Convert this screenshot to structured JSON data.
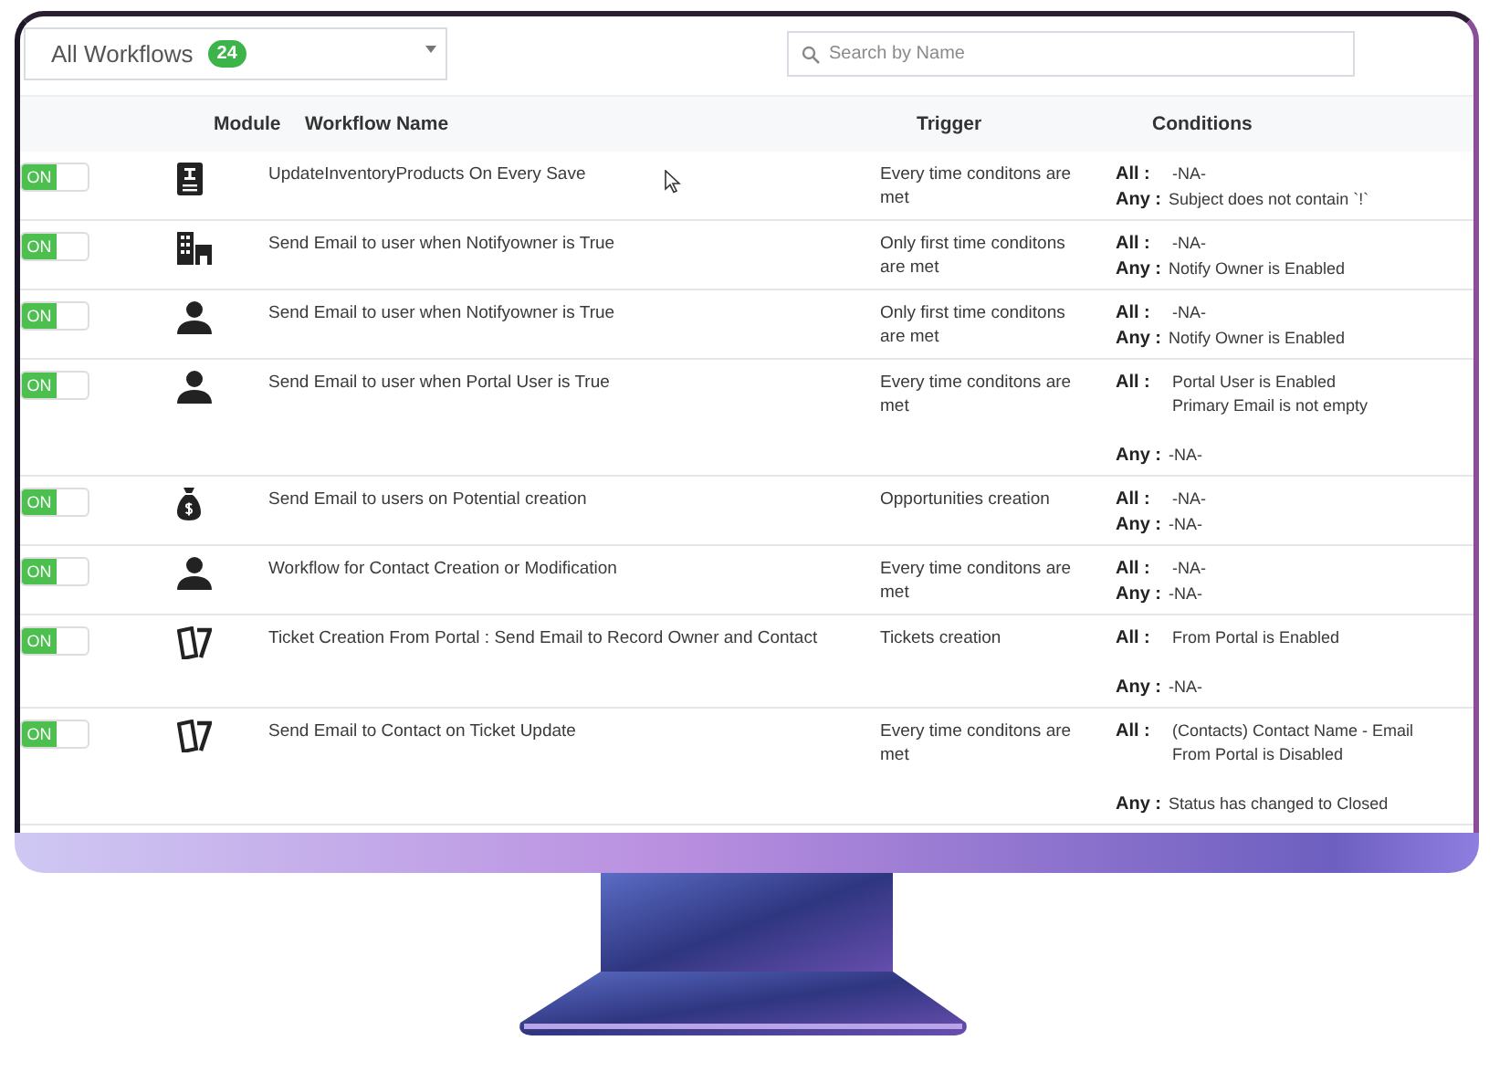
{
  "filter": {
    "label": "All Workflows",
    "count": "24"
  },
  "search": {
    "placeholder": "Search by Name"
  },
  "columns": [
    "Module",
    "Workflow Name",
    "Trigger",
    "Conditions"
  ],
  "rows": [
    {
      "on": true,
      "toggle_label": "ON",
      "kind": "product",
      "name": "UpdateInventoryProducts On Every Save",
      "trigger": "Every time conditons are met",
      "conditions": {
        "kind": "compact",
        "all_label": "All :",
        "all": [
          "-NA-"
        ],
        "any_label": "Any :",
        "any": [
          "Subject does not contain `!`"
        ]
      }
    },
    {
      "on": true,
      "toggle_label": "ON",
      "kind": "organization",
      "name": "Send Email to user when Notifyowner is True",
      "trigger": "Only first time conditons are met",
      "conditions": {
        "kind": "compact",
        "all_label": "All :",
        "all": [
          "-NA-"
        ],
        "any_label": "Any :",
        "any": [
          "Notify Owner is Enabled"
        ]
      }
    },
    {
      "on": true,
      "toggle_label": "ON",
      "kind": "contact",
      "name": "Send Email to user when Notifyowner is True",
      "trigger": "Only first time conditons are met",
      "conditions": {
        "kind": "compact",
        "all_label": "All :",
        "all": [
          "-NA-"
        ],
        "any_label": "Any :",
        "any": [
          "Notify Owner is Enabled"
        ]
      }
    },
    {
      "on": true,
      "toggle_label": "ON",
      "kind": "contact",
      "name": "Send Email to user when Portal User is True",
      "trigger": "Every time conditons are met",
      "conditions": {
        "kind": "spaced",
        "all_label": "All :",
        "all": [
          "Portal User is Enabled",
          "Primary Email is not empty"
        ],
        "any_label": "Any :",
        "any": [
          "-NA-"
        ]
      }
    },
    {
      "on": true,
      "toggle_label": "ON",
      "kind": "opportunity",
      "name": "Send Email to users on Potential creation",
      "trigger": "Opportunities creation",
      "conditions": {
        "kind": "compact",
        "all_label": "All :",
        "all": [
          "-NA-"
        ],
        "any_label": "Any :",
        "any": [
          "-NA-"
        ]
      }
    },
    {
      "on": true,
      "toggle_label": "ON",
      "kind": "contact",
      "name": "Workflow for Contact Creation or Modification",
      "trigger": "Every time conditons are met",
      "conditions": {
        "kind": "compact",
        "all_label": "All :",
        "all": [
          "-NA-"
        ],
        "any_label": "Any :",
        "any": [
          "-NA-"
        ]
      }
    },
    {
      "on": true,
      "toggle_label": "ON",
      "kind": "ticket",
      "name": "Ticket Creation From Portal : Send Email to Record Owner and Contact",
      "trigger": "Tickets creation",
      "conditions": {
        "kind": "spaced",
        "all_label": "All :",
        "all": [
          "From Portal is Enabled"
        ],
        "any_label": "Any :",
        "any": [
          "-NA-"
        ]
      }
    },
    {
      "on": true,
      "toggle_label": "ON",
      "kind": "ticket",
      "name": "Send Email to Contact on Ticket Update",
      "trigger": "Every time conditons are met",
      "conditions": {
        "kind": "spaced",
        "all_label": "All :",
        "all": [
          "(Contacts) Contact Name - Email",
          "From Portal is Disabled"
        ],
        "any_label": "Any :",
        "any": [
          "Status has changed to Closed"
        ]
      }
    }
  ]
}
